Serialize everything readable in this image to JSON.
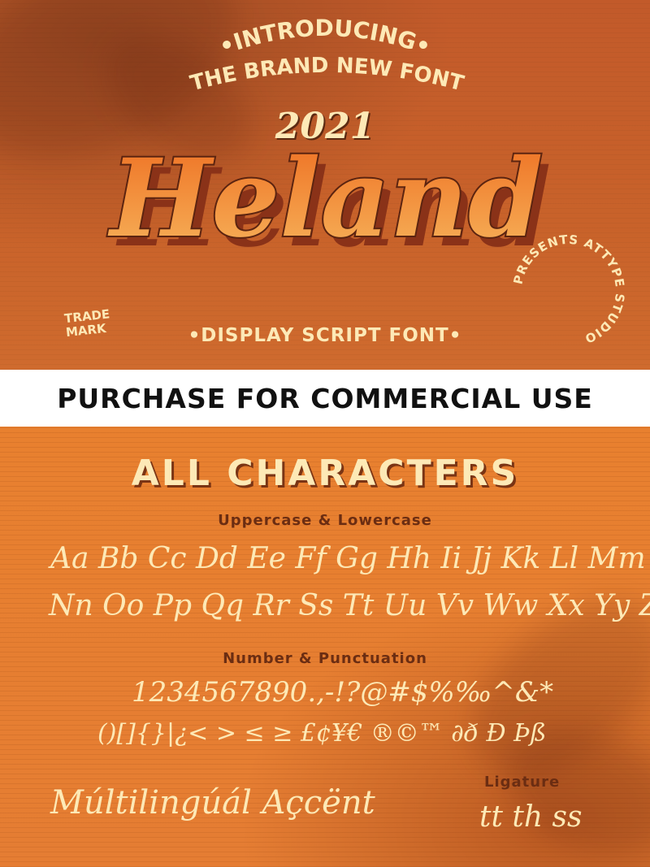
{
  "header": {
    "intro_line1": "•INTRODUCING•",
    "intro_line2": "THE BRAND NEW FONT",
    "year": "2021",
    "title": "Heland",
    "trademark": "TRADE MARK",
    "subtitle": "•DISPLAY SCRIPT FONT•",
    "circle_text": "PRESENTS ATTYPE STUDIO"
  },
  "banner": {
    "text": "PURCHASE FOR COMMERCIAL USE"
  },
  "characters": {
    "heading": "ALL CHARACTERS",
    "upper_lower_label": "Uppercase & Lowercase",
    "alpha_row1": "Aa Bb Cc Dd Ee Ff Gg Hh Ii Jj Kk Ll Mm",
    "alpha_row2": "Nn Oo Pp Qq Rr Ss Tt Uu Vv Ww Xx Yy Zz",
    "number_label": "Number & Punctuation",
    "number_row1": "1234567890.,-!?@#$%‰^&*",
    "number_row2": "()[]{}|¿< > ≤ ≥ £¢¥€ ®©™ ∂ð Ð Þß",
    "multilingual": "Múltilingúál Açcënt",
    "ligature_label": "Ligature",
    "ligature_sample": "tt th ss"
  },
  "colors": {
    "cream": "#fde9b6",
    "dark_brown": "#6b2d12",
    "title_orange_top": "#f07a2a",
    "title_orange_bottom": "#f6b25a",
    "title_shadow": "#8a3218"
  }
}
